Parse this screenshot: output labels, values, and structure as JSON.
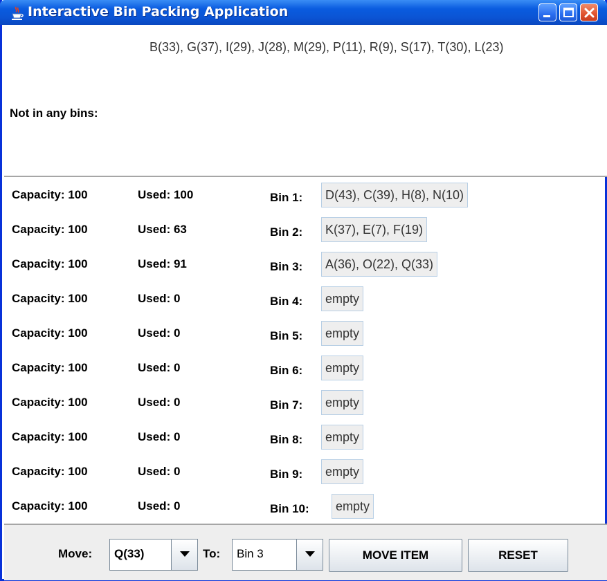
{
  "window": {
    "title": "Interactive Bin Packing Application",
    "titlebar_color": "#0a5ce0",
    "icon": "java-cup-icon"
  },
  "unassigned": {
    "label": "Not in any bins:",
    "items_text": "B(33), G(37), I(29), J(28), M(29), P(11), R(9), S(17), T(30), L(23)"
  },
  "bins": [
    {
      "capacity": "Capacity: 100",
      "used": "Used: 100",
      "label": "Bin 1:",
      "contents": "D(43), C(39), H(8), N(10)"
    },
    {
      "capacity": "Capacity: 100",
      "used": "Used: 63",
      "label": "Bin 2:",
      "contents": "K(37), E(7), F(19)"
    },
    {
      "capacity": "Capacity: 100",
      "used": "Used: 91",
      "label": "Bin 3:",
      "contents": "A(36), O(22), Q(33)"
    },
    {
      "capacity": "Capacity: 100",
      "used": "Used: 0",
      "label": "Bin 4:",
      "contents": "empty"
    },
    {
      "capacity": "Capacity: 100",
      "used": "Used: 0",
      "label": "Bin 5:",
      "contents": "empty"
    },
    {
      "capacity": "Capacity: 100",
      "used": "Used: 0",
      "label": "Bin 6:",
      "contents": "empty"
    },
    {
      "capacity": "Capacity: 100",
      "used": "Used: 0",
      "label": "Bin 7:",
      "contents": "empty"
    },
    {
      "capacity": "Capacity: 100",
      "used": "Used: 0",
      "label": "Bin 8:",
      "contents": "empty"
    },
    {
      "capacity": "Capacity: 100",
      "used": "Used: 0",
      "label": "Bin 9:",
      "contents": "empty"
    },
    {
      "capacity": "Capacity: 100",
      "used": "Used: 0",
      "label": "Bin 10:",
      "contents": "empty"
    }
  ],
  "controls": {
    "move_label": "Move:",
    "move_selected": "Q(33)",
    "to_label": "To:",
    "to_selected": "Bin 3",
    "move_button": "MOVE ITEM",
    "reset_button": "RESET"
  }
}
